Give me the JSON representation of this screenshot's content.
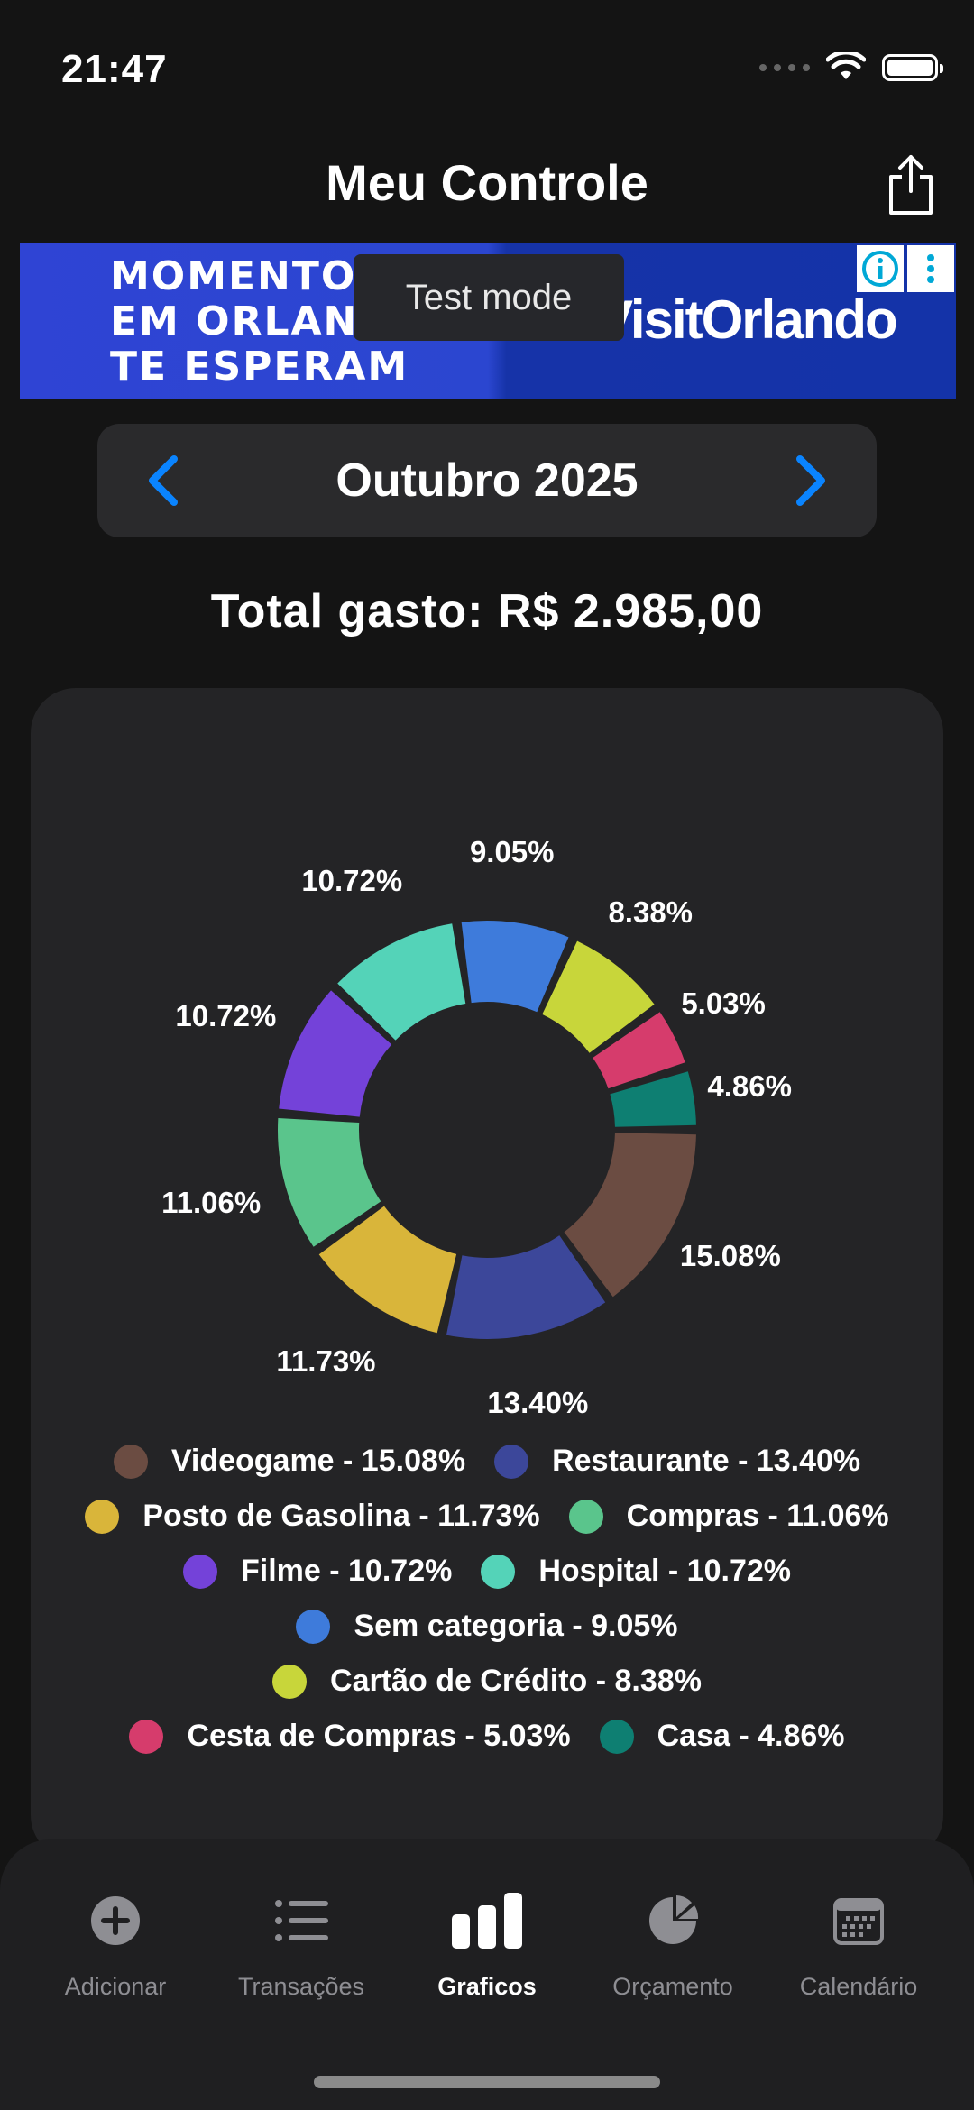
{
  "status": {
    "time": "21:47"
  },
  "header": {
    "title": "Meu Controle",
    "share_icon": "share-icon"
  },
  "ad": {
    "line1": "MOMENTOS",
    "line2": "EM ORLANDO",
    "line3": "TE ESPERAM",
    "brand": "VisitOrlando",
    "test_mode": "Test mode"
  },
  "month_nav": {
    "label": "Outubro 2025",
    "prev_icon": "chevron-left-icon",
    "next_icon": "chevron-right-icon",
    "accent": "#0a84ff"
  },
  "total": {
    "text": "Total gasto: R$ 2.985,00"
  },
  "chart_data": {
    "type": "pie",
    "donut": true,
    "categories": [
      "Videogame",
      "Restaurante",
      "Posto de Gasolina",
      "Compras",
      "Filme",
      "Hospital",
      "Sem categoria",
      "Cartão de Crédito",
      "Cesta de Compras",
      "Casa"
    ],
    "values": [
      15.08,
      13.4,
      11.73,
      11.06,
      10.72,
      10.72,
      9.05,
      8.38,
      5.03,
      4.86
    ],
    "labels": [
      "15.08%",
      "13.40%",
      "11.73%",
      "11.06%",
      "10.72%",
      "10.72%",
      "9.05%",
      "8.38%",
      "5.03%",
      "4.86%"
    ],
    "colors": [
      "#6b4c42",
      "#3c479a",
      "#d9b53a",
      "#5ac58c",
      "#7442d9",
      "#54d3b8",
      "#3e7bdb",
      "#c8d63a",
      "#d63c6c",
      "#0e7f72"
    ],
    "legend": [
      "Videogame - 15.08%",
      "Restaurante - 13.40%",
      "Posto de Gasolina - 11.73%",
      "Compras - 11.06%",
      "Filme - 10.72%",
      "Hospital - 10.72%",
      "Sem categoria - 9.05%",
      "Cartão de Crédito - 8.38%",
      "Cesta de Compras - 5.03%",
      "Casa - 4.86%"
    ]
  },
  "tabs": [
    {
      "label": "Adicionar",
      "icon": "plus-circle-icon"
    },
    {
      "label": "Transações",
      "icon": "list-icon"
    },
    {
      "label": "Graficos",
      "icon": "bar-chart-icon",
      "active": true
    },
    {
      "label": "Orçamento",
      "icon": "pie-chart-icon"
    },
    {
      "label": "Calendário",
      "icon": "calendar-icon"
    }
  ]
}
